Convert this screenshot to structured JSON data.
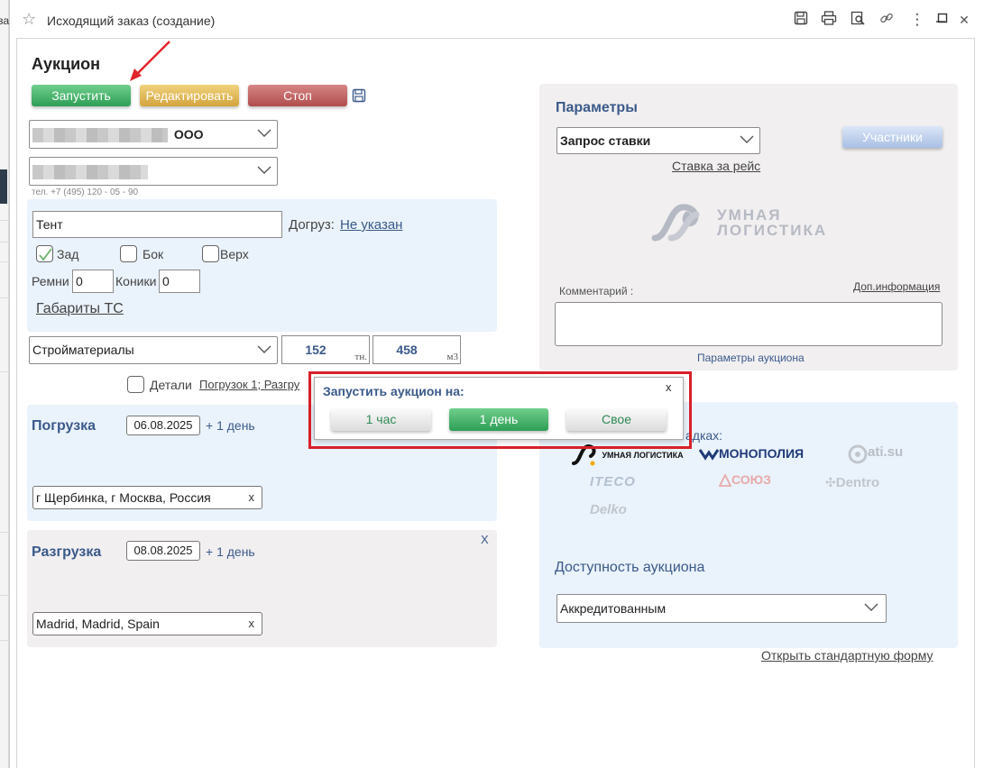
{
  "window": {
    "title": "Исходящий заказ (создание)",
    "toolbar_icons": [
      "save-icon",
      "print-icon",
      "preview-icon",
      "link-icon",
      "more-icon",
      "minimize-icon",
      "maximize-icon",
      "close-icon"
    ],
    "more_glyph": "⋮",
    "close_glyph": "✕"
  },
  "background_app": {
    "partial_text": "за"
  },
  "auction": {
    "heading": "Аукцион",
    "start_button": "Запустить",
    "edit_button": "Редактировать",
    "stop_button": "Стоп"
  },
  "company": {
    "suffix": "ООО"
  },
  "phone": "тел. +7 (495) 120 - 05 - 90",
  "vehicle": {
    "body_type": "Тент",
    "extra_load_label": "Догруз:",
    "extra_load_value": "Не указан",
    "checkboxes": [
      {
        "label": "Зад",
        "checked": true
      },
      {
        "label": "Бок",
        "checked": false
      },
      {
        "label": "Верх",
        "checked": false
      }
    ],
    "belts_label": "Ремни",
    "belts_value": "0",
    "cones_label": "Коники",
    "cones_value": "0",
    "dimensions_link": "Габариты ТС"
  },
  "cargo": {
    "type": "Стройматериалы",
    "weight": "152",
    "weight_unit": "тн.",
    "volume": "458",
    "volume_unit": "м3",
    "details_label": "Детали",
    "details_link": "Погрузок 1; Разгру"
  },
  "loading": {
    "title": "Погрузка",
    "date": "06.08.2025",
    "plus_day": "+ 1 день",
    "address": "г Щербинка, г Москва, Россия",
    "clear": "x"
  },
  "unloading": {
    "title": "Разгрузка",
    "date": "08.08.2025",
    "plus_day": "+ 1 день",
    "address": "Madrid, Madrid, Spain",
    "clear": "x",
    "remove": "X"
  },
  "params": {
    "title": "Параметры",
    "request_type": "Запрос ставки",
    "rate_link": "Ставка за рейс",
    "participants_button": "Участники",
    "logo_line1": "УМНАЯ",
    "logo_line2": "ЛОГИСТИКА",
    "comment_label": "Комментарий :",
    "extra_info_link": "Доп.информация",
    "auction_params": "Параметры аукциона"
  },
  "platforms": {
    "label_partial": "адках:",
    "logos": [
      "УМНАЯ ЛОГИСТИКА",
      "МОНОПОЛИЯ",
      "ati.su",
      "ITECO",
      "СОЮЗ",
      "Dentro",
      "Delko"
    ]
  },
  "availability": {
    "title": "Доступность аукциона",
    "value": "Аккредитованным"
  },
  "standard_form_link": "Открыть стандартную форму",
  "modal": {
    "title": "Запустить аукцион на:",
    "close": "x",
    "options": [
      "1 час",
      "1 день",
      "Свое"
    ],
    "selected": "1 день"
  },
  "colors": {
    "accent_blue": "#3b5a8a",
    "start_green": "#2e9e56",
    "edit_yellow": "#d3a43c",
    "stop_red": "#b14d4d",
    "highlight_red": "#d8202a"
  }
}
